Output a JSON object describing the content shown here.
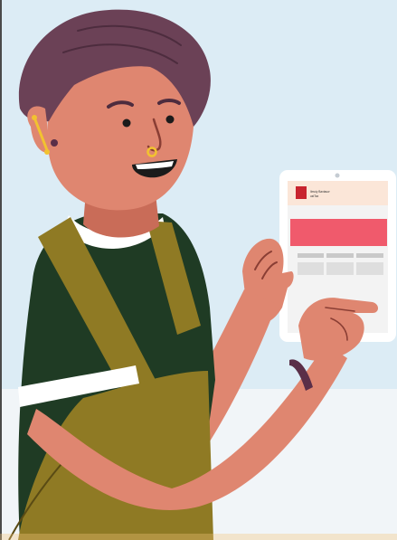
{
  "illustration": {
    "subject": "person-holding-tablet",
    "tablet": {
      "brand_line_1": "Ilmuiy Baxtauw",
      "brand_line_2": "ustTax"
    }
  },
  "colors": {
    "sky": "#dcecf5",
    "floor": "#f1f5f8",
    "skin": "#df8670",
    "skin_shadow": "#c96c58",
    "hair": "#6b4156",
    "shirt": "#1f3b24",
    "overall": "#8f7a24",
    "collar": "#ffffff",
    "earring": "#f2c230",
    "tablet_frame": "#ffffff",
    "tablet_header": "#fbe6d8",
    "tablet_banner": "#f05a6c",
    "tablet_cell": "#d9d9d9",
    "logo": "#c8242f",
    "watch": "#5a2f48"
  }
}
